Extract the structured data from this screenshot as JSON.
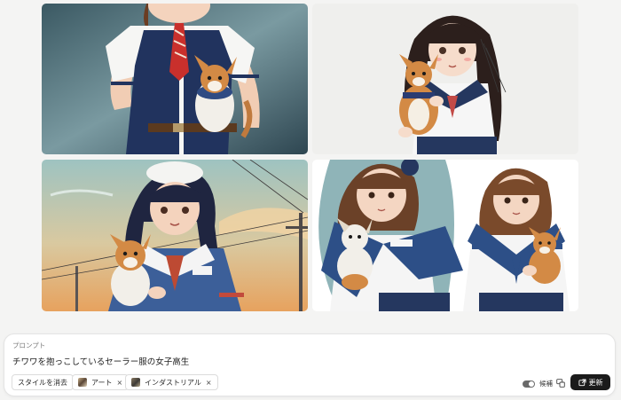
{
  "prompt": {
    "label": "プロンプト",
    "text": "チワワを抱っこしているセーラー服の女子高生"
  },
  "chips": {
    "clear_style": "スタイルを消去",
    "art": "アート",
    "industrial": "インダストリアル",
    "remove_symbol": "×"
  },
  "controls": {
    "candidates_label": "候補",
    "update_label": "更新",
    "toggle_on": true
  },
  "images": [
    {
      "subject": "girl-in-sailor-uniform-holding-chihuahua",
      "style": "illustration"
    },
    {
      "subject": "girl-in-sailor-uniform-holding-chihuahua",
      "style": "anime"
    },
    {
      "subject": "girl-in-sailor-uniform-holding-chihuahua",
      "style": "sunset-utility-poles"
    },
    {
      "subject": "two-girls-in-sailor-uniform-holding-chihuahuas",
      "style": "flat-illustration"
    }
  ],
  "colors": {
    "update_button_bg": "#1b1b1b",
    "uniform_navy": "#22345f",
    "chihuahua_tan": "#d38a45"
  },
  "icons": [
    "close-icon",
    "toggle-switch",
    "candidates-icon",
    "external-link-icon"
  ]
}
